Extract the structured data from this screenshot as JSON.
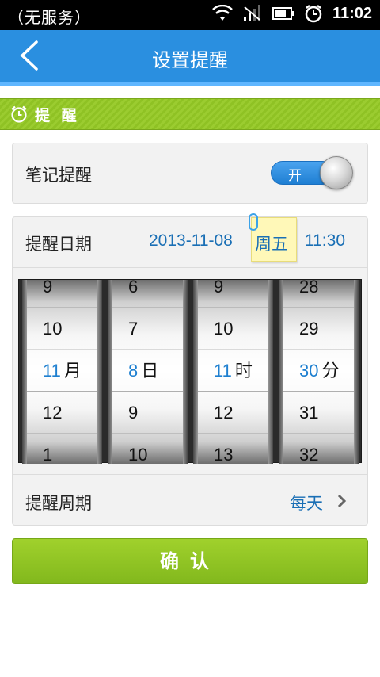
{
  "status_bar": {
    "carrier": "（无服务）",
    "time": "11:02"
  },
  "header": {
    "title": "设置提醒"
  },
  "section": {
    "title": "提 醒"
  },
  "note_reminder": {
    "label": "笔记提醒",
    "toggle_text": "开",
    "enabled": true
  },
  "reminder_date": {
    "label": "提醒日期",
    "date": "2013-11-08",
    "weekday": "周五",
    "time": "11:30"
  },
  "picker": {
    "month": {
      "rows": [
        "9",
        "10",
        "11",
        "12",
        "1"
      ],
      "selected_index": 2,
      "unit": "月"
    },
    "day": {
      "rows": [
        "6",
        "7",
        "8",
        "9",
        "10"
      ],
      "selected_index": 2,
      "unit": "日"
    },
    "hour": {
      "rows": [
        "9",
        "10",
        "11",
        "12",
        "13"
      ],
      "selected_index": 2,
      "unit": "时"
    },
    "minute": {
      "rows": [
        "28",
        "29",
        "30",
        "31",
        "32"
      ],
      "selected_index": 2,
      "unit": "分"
    }
  },
  "reminder_period": {
    "label": "提醒周期",
    "value": "每天"
  },
  "confirm_button": {
    "label": "确认"
  },
  "colors": {
    "title_bar": "#2a8fe0",
    "section_green": "#8fc224",
    "value_blue": "#1a6fb5",
    "confirm_green": "#8cc224"
  }
}
